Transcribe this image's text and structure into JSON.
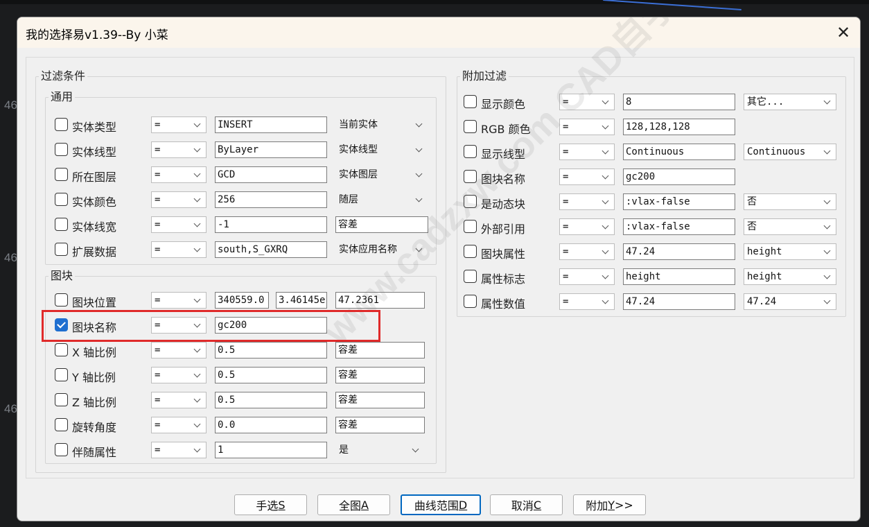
{
  "background": {
    "edge_labels": [
      "46",
      "46",
      "46"
    ]
  },
  "window": {
    "title": "我的选择易v1.39--By 小菜",
    "close_glyph": "✕"
  },
  "filter_conditions": {
    "legend": "过滤条件",
    "general": {
      "legend": "通用",
      "rows": [
        {
          "label": "实体类型",
          "checked": false,
          "op": "=",
          "value": "INSERT",
          "extra": "当前实体",
          "extra_style": "dropdown"
        },
        {
          "label": "实体线型",
          "checked": false,
          "op": "=",
          "value": "ByLayer",
          "extra": "实体线型",
          "extra_style": "dropdown"
        },
        {
          "label": "所在图层",
          "checked": false,
          "op": "=",
          "value": "GCD",
          "extra": "实体图层",
          "extra_style": "dropdown"
        },
        {
          "label": "实体颜色",
          "checked": false,
          "op": "=",
          "value": "256",
          "extra": "随层",
          "extra_style": "dropdown"
        },
        {
          "label": "实体线宽",
          "checked": false,
          "op": "=",
          "value": "-1",
          "extra": "容差",
          "extra_style": "textbox"
        },
        {
          "label": "扩展数据",
          "checked": false,
          "op": "=",
          "value": "south,S_GXRQ",
          "extra": "实体应用名称",
          "extra_style": "dropdown"
        }
      ]
    },
    "block": {
      "legend": "图块",
      "position_row": {
        "label": "图块位置",
        "checked": false,
        "op": "=",
        "x": "340559.0",
        "y": "3.46145e",
        "z": "47.2361"
      },
      "name_row": {
        "label": "图块名称",
        "checked": true,
        "op": "=",
        "value": "gc200"
      },
      "rows": [
        {
          "label": "X 轴比例",
          "checked": false,
          "op": "=",
          "value": "0.5",
          "extra": "容差",
          "extra_style": "textbox"
        },
        {
          "label": "Y 轴比例",
          "checked": false,
          "op": "=",
          "value": "0.5",
          "extra": "容差",
          "extra_style": "textbox"
        },
        {
          "label": "Z 轴比例",
          "checked": false,
          "op": "=",
          "value": "0.5",
          "extra": "容差",
          "extra_style": "textbox"
        },
        {
          "label": "旋转角度",
          "checked": false,
          "op": "=",
          "value": "0.0",
          "extra": "容差",
          "extra_style": "textbox"
        },
        {
          "label": "伴随属性",
          "checked": false,
          "op": "=",
          "value": "1",
          "extra": "是",
          "extra_style": "dropdown"
        }
      ]
    }
  },
  "additional_filter": {
    "legend": "附加过滤",
    "rows": [
      {
        "label": "显示颜色",
        "checked": false,
        "op": "=",
        "value": "8",
        "extra": "其它..."
      },
      {
        "label": "RGB 颜色",
        "checked": false,
        "op": "=",
        "value": "128,128,128",
        "extra": null
      },
      {
        "label": "显示线型",
        "checked": false,
        "op": "=",
        "value": "Continuous",
        "extra": "Continuous"
      },
      {
        "label": "图块名称",
        "checked": false,
        "op": "=",
        "value": "gc200",
        "extra": null
      },
      {
        "label": "是动态块",
        "checked": false,
        "op": "=",
        "value": ":vlax-false",
        "extra": "否"
      },
      {
        "label": "外部引用",
        "checked": false,
        "op": "=",
        "value": ":vlax-false",
        "extra": "否"
      },
      {
        "label": "图块属性",
        "checked": false,
        "op": "=",
        "value": "47.24",
        "extra": "height"
      },
      {
        "label": "属性标志",
        "checked": false,
        "op": "=",
        "value": "height",
        "extra": "height"
      },
      {
        "label": "属性数值",
        "checked": false,
        "op": "=",
        "value": "47.24",
        "extra": "47.24"
      }
    ]
  },
  "watermark": "www.cadzxw.com CAD自学网",
  "buttons": [
    {
      "id": "manual",
      "text": "手选",
      "key": "S",
      "suffix": "",
      "default": false
    },
    {
      "id": "all",
      "text": "全图",
      "key": "A",
      "suffix": "",
      "default": false
    },
    {
      "id": "curve",
      "text": "曲线范围",
      "key": "D",
      "suffix": "",
      "default": true
    },
    {
      "id": "cancel",
      "text": "取消",
      "key": "C",
      "suffix": "",
      "default": false
    },
    {
      "id": "additional",
      "text": "附加",
      "key": "Y",
      "suffix": ">>",
      "default": false
    }
  ],
  "colors": {
    "highlight": "#e02a2a",
    "checkbox_checked": "#1f6fd0",
    "default_button_border": "#0067c0"
  }
}
